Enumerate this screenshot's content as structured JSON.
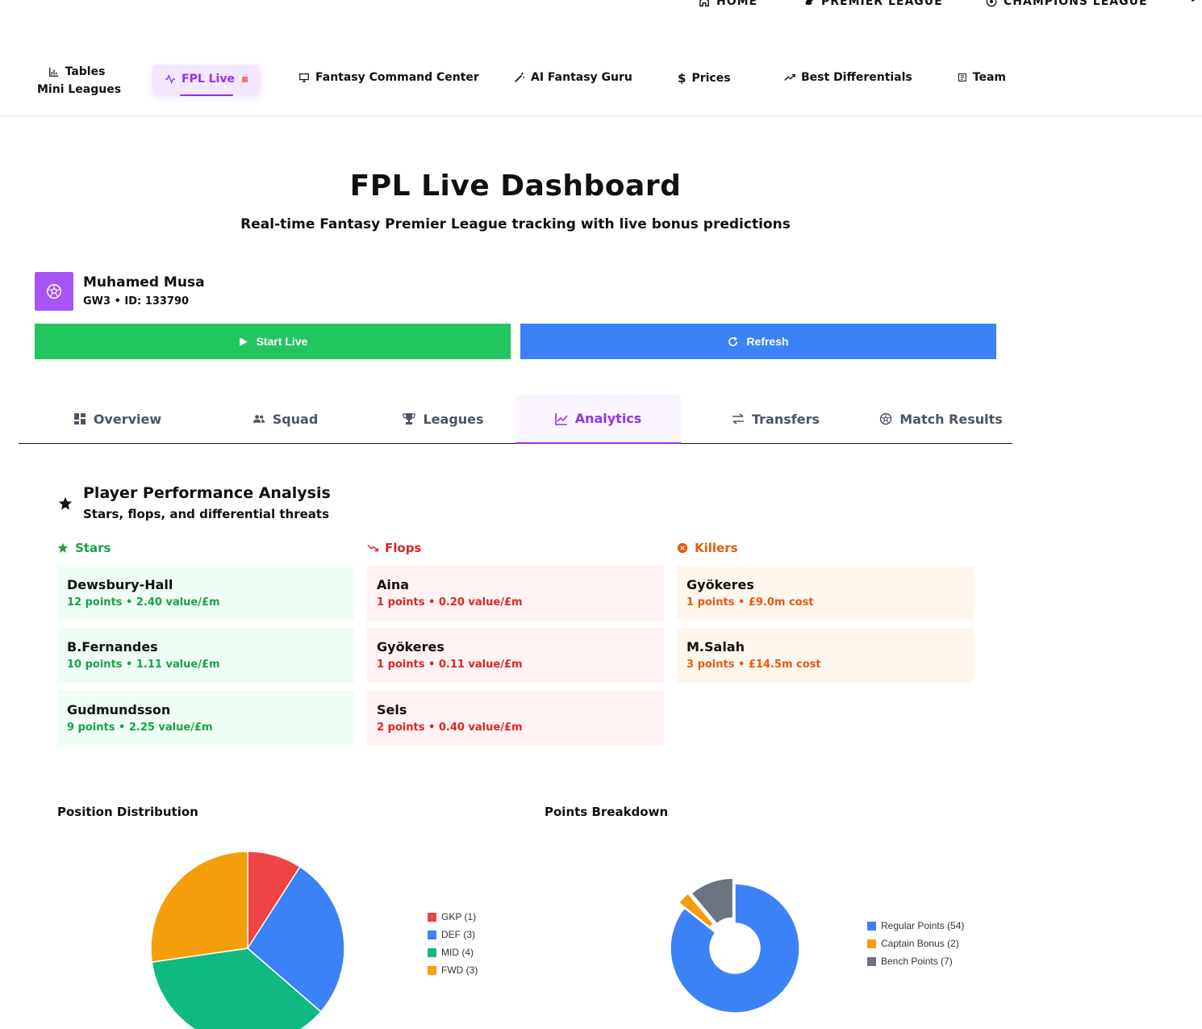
{
  "top_nav": {
    "home": "HOME",
    "premier_league": "PREMIER LEAGUE",
    "champions_league": "CHAMPIONS LEAGUE"
  },
  "sub_nav": {
    "tables_line1": "Tables",
    "tables_line2": "Mini Leagues",
    "fpl_live": "FPL Live",
    "fantasy_command_center": "Fantasy Command Center",
    "ai_fantasy_guru": "AI Fantasy Guru",
    "prices": "Prices",
    "best_differentials": "Best Differentials",
    "team": "Team"
  },
  "hero": {
    "title": "FPL Live Dashboard",
    "subtitle": "Real-time Fantasy Premier League tracking with live bonus predictions"
  },
  "manager": {
    "name": "Muhamed Musa",
    "meta": "GW3 • ID: 133790"
  },
  "buttons": {
    "start_live": "Start Live",
    "refresh": "Refresh"
  },
  "tabs": [
    "Overview",
    "Squad",
    "Leagues",
    "Analytics",
    "Transfers",
    "Match Results"
  ],
  "active_tab": "Analytics",
  "performance": {
    "title": "Player Performance Analysis",
    "subtitle": "Stars, flops, and differential threats",
    "stars_label": "Stars",
    "flops_label": "Flops",
    "killers_label": "Killers",
    "stars": [
      {
        "name": "Dewsbury-Hall",
        "stat": "12 points • 2.40 value/£m"
      },
      {
        "name": "B.Fernandes",
        "stat": "10 points • 1.11 value/£m"
      },
      {
        "name": "Gudmundsson",
        "stat": "9 points • 2.25 value/£m"
      }
    ],
    "flops": [
      {
        "name": "Aina",
        "stat": "1 points • 0.20 value/£m"
      },
      {
        "name": "Gyökeres",
        "stat": "1 points • 0.11 value/£m"
      },
      {
        "name": "Sels",
        "stat": "2 points • 0.40 value/£m"
      }
    ],
    "killers": [
      {
        "name": "Gyökeres",
        "stat": "1 points • £9.0m cost"
      },
      {
        "name": "M.Salah",
        "stat": "3 points • £14.5m cost"
      }
    ]
  },
  "colors": {
    "purple": "#9333ea",
    "green": "#22c55e",
    "blue": "#3b82f6",
    "red": "#ef4444",
    "emerald": "#10b981",
    "amber": "#f59e0b",
    "slate": "#6b7280"
  },
  "chart_data": [
    {
      "type": "pie",
      "title": "Position Distribution",
      "categories": [
        "GKP (1)",
        "DEF (3)",
        "MID (4)",
        "FWD (3)"
      ],
      "values": [
        1,
        3,
        4,
        3
      ],
      "colors": [
        "#ef4444",
        "#3b82f6",
        "#10b981",
        "#f59e0b"
      ],
      "legend": "right"
    },
    {
      "type": "pie",
      "title": "Points Breakdown",
      "categories": [
        "Regular Points (54)",
        "Captain Bonus (2)",
        "Bench Points (7)"
      ],
      "values": [
        54,
        2,
        7
      ],
      "colors": [
        "#3b82f6",
        "#f59e0b",
        "#6b7280"
      ],
      "donut": true,
      "exploded": true,
      "legend": "right"
    }
  ]
}
